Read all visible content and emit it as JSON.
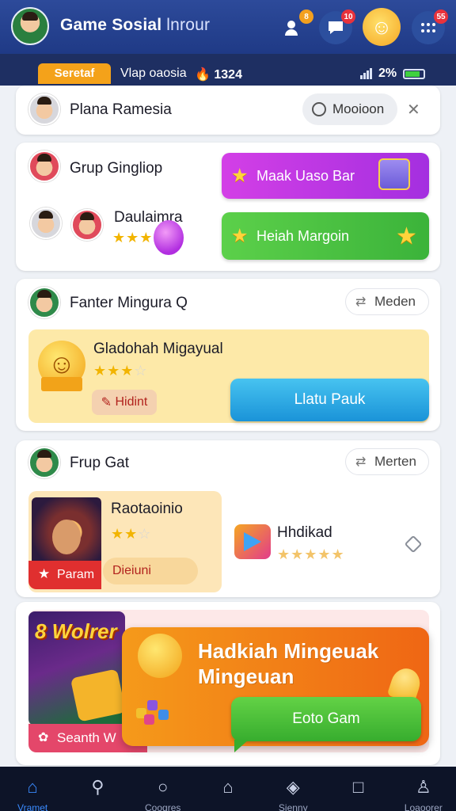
{
  "header": {
    "title": "Game Sosial",
    "title_sub": " lnrour",
    "notif_users": "8",
    "notif_chat": "10",
    "notif_more": "55"
  },
  "status_strip": {
    "tab_label": "Seretaf",
    "text_1": "Vlap oaosia",
    "time": "1324",
    "battery": "2%"
  },
  "search_card": {
    "name": "Plana Ramesia",
    "search_placeholder": "Mooioon"
  },
  "group_card": {
    "name": "Grup Gingliop",
    "purple_button": "Maak Uaso Bar",
    "sub_name": "Daulaimra",
    "green_button": "Heiah Margoin"
  },
  "game_card": {
    "name": "Fanter Mingura Q",
    "follow": "Meden",
    "game_title": "Gladohah Migayual",
    "chip": "Hidint",
    "play_button": "Llatu Pauk"
  },
  "frup_card": {
    "name": "Frup Gat",
    "follow": "Merten",
    "left_title": "Raotaoinio",
    "left_tag": "Param",
    "left_chip": "Dieiuni",
    "right_title": "Hhdikad"
  },
  "promo": {
    "thumb_title": "8 Wolrer",
    "tag": "Seanth W",
    "headline": "Hadkiah Mingeuak Mingeuan",
    "cta": "Eoto Gam"
  },
  "bottom_nav": [
    {
      "label": "Vramet",
      "icon": "home-icon"
    },
    {
      "label": "",
      "icon": "search-icon"
    },
    {
      "label": "Cooqres",
      "icon": "explore-icon"
    },
    {
      "label": "",
      "icon": "house-icon"
    },
    {
      "label": "Sienny",
      "icon": "box-icon"
    },
    {
      "label": "",
      "icon": "square-icon"
    },
    {
      "label": "Loaoorer",
      "icon": "profile-icon"
    }
  ],
  "colors": {
    "header": "#2d4a9a",
    "accent_purple": "#d33fe6",
    "accent_green": "#4cc043",
    "accent_blue": "#1a93d8",
    "accent_orange": "#f59a1a"
  }
}
